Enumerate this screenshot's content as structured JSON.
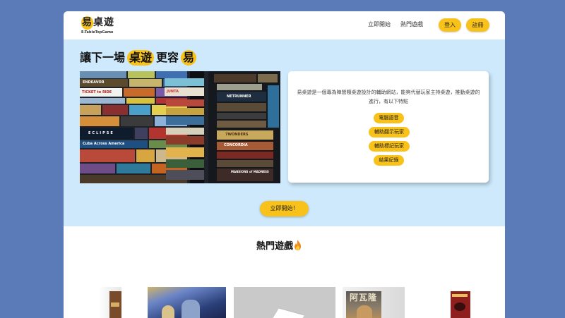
{
  "brand": {
    "logo_text": "易桌遊",
    "logo_highlight": "易",
    "logo_rest": "桌遊",
    "subtitle": "E-TableTopGame",
    "accent_color": "#f9c21a"
  },
  "nav": {
    "start_now": "立即開始",
    "popular_games": "熱門遊戲",
    "login": "登入",
    "register": "註冊"
  },
  "hero": {
    "headline_part1": "讓下一場",
    "headline_hl1": "桌遊",
    "headline_part2": "更容",
    "headline_hl2": "易",
    "description": "易桌遊是一個專為陣營類桌遊設計的輔助網站，能夠代替玩家主持桌遊，推動桌遊的進行，有以下特點",
    "features": [
      "電腦語音",
      "輔助翻示玩家",
      "輔助標記玩家",
      "結果紀錄"
    ],
    "cta": "立即開始！",
    "shelf_labels": [
      "ENDEAVOR",
      "TICKET to RIDE",
      "JUNTA",
      "NETRUNNER",
      "ECLIPSE",
      "7WONDERS",
      "Cuba Across America",
      "CONCORDIA",
      "MANSIONS of MADNESS"
    ]
  },
  "popular": {
    "title": "熱門遊戲",
    "fire_icon": "fire-icon",
    "thumb_text": "阿瓦隆"
  }
}
